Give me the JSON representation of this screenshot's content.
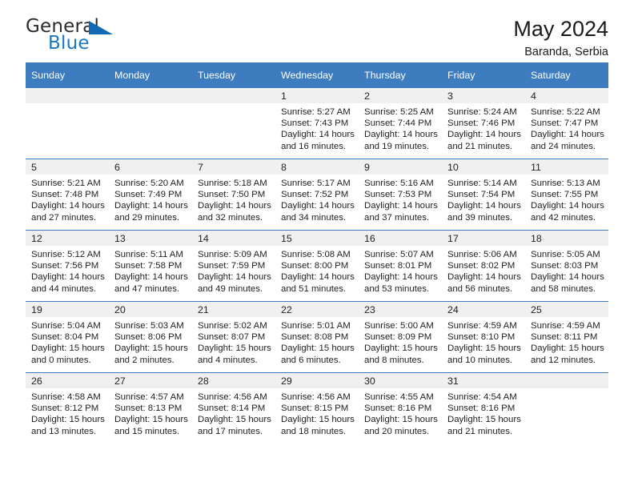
{
  "brand": {
    "name_top": "General",
    "name_bottom": "Blue",
    "accent_color": "#1168b3",
    "text_color": "#2b2b2b",
    "triangle_icon": "triangle-icon"
  },
  "header": {
    "title": "May 2024",
    "subtitle": "Baranda, Serbia",
    "header_bg": "#3c7cbf",
    "daynum_bg": "#f0f0f0"
  },
  "weekday_headers": [
    "Sunday",
    "Monday",
    "Tuesday",
    "Wednesday",
    "Thursday",
    "Friday",
    "Saturday"
  ],
  "labels": {
    "sunrise_prefix": "Sunrise:",
    "sunset_prefix": "Sunset:",
    "daylight_prefix": "Daylight:"
  },
  "weeks": [
    [
      {
        "day": "",
        "empty": true
      },
      {
        "day": "",
        "empty": true
      },
      {
        "day": "",
        "empty": true
      },
      {
        "day": "1",
        "sunrise": "Sunrise: 5:27 AM",
        "sunset": "Sunset: 7:43 PM",
        "daylight1": "Daylight: 14 hours",
        "daylight2": "and 16 minutes."
      },
      {
        "day": "2",
        "sunrise": "Sunrise: 5:25 AM",
        "sunset": "Sunset: 7:44 PM",
        "daylight1": "Daylight: 14 hours",
        "daylight2": "and 19 minutes."
      },
      {
        "day": "3",
        "sunrise": "Sunrise: 5:24 AM",
        "sunset": "Sunset: 7:46 PM",
        "daylight1": "Daylight: 14 hours",
        "daylight2": "and 21 minutes."
      },
      {
        "day": "4",
        "sunrise": "Sunrise: 5:22 AM",
        "sunset": "Sunset: 7:47 PM",
        "daylight1": "Daylight: 14 hours",
        "daylight2": "and 24 minutes."
      }
    ],
    [
      {
        "day": "5",
        "sunrise": "Sunrise: 5:21 AM",
        "sunset": "Sunset: 7:48 PM",
        "daylight1": "Daylight: 14 hours",
        "daylight2": "and 27 minutes."
      },
      {
        "day": "6",
        "sunrise": "Sunrise: 5:20 AM",
        "sunset": "Sunset: 7:49 PM",
        "daylight1": "Daylight: 14 hours",
        "daylight2": "and 29 minutes."
      },
      {
        "day": "7",
        "sunrise": "Sunrise: 5:18 AM",
        "sunset": "Sunset: 7:50 PM",
        "daylight1": "Daylight: 14 hours",
        "daylight2": "and 32 minutes."
      },
      {
        "day": "8",
        "sunrise": "Sunrise: 5:17 AM",
        "sunset": "Sunset: 7:52 PM",
        "daylight1": "Daylight: 14 hours",
        "daylight2": "and 34 minutes."
      },
      {
        "day": "9",
        "sunrise": "Sunrise: 5:16 AM",
        "sunset": "Sunset: 7:53 PM",
        "daylight1": "Daylight: 14 hours",
        "daylight2": "and 37 minutes."
      },
      {
        "day": "10",
        "sunrise": "Sunrise: 5:14 AM",
        "sunset": "Sunset: 7:54 PM",
        "daylight1": "Daylight: 14 hours",
        "daylight2": "and 39 minutes."
      },
      {
        "day": "11",
        "sunrise": "Sunrise: 5:13 AM",
        "sunset": "Sunset: 7:55 PM",
        "daylight1": "Daylight: 14 hours",
        "daylight2": "and 42 minutes."
      }
    ],
    [
      {
        "day": "12",
        "sunrise": "Sunrise: 5:12 AM",
        "sunset": "Sunset: 7:56 PM",
        "daylight1": "Daylight: 14 hours",
        "daylight2": "and 44 minutes."
      },
      {
        "day": "13",
        "sunrise": "Sunrise: 5:11 AM",
        "sunset": "Sunset: 7:58 PM",
        "daylight1": "Daylight: 14 hours",
        "daylight2": "and 47 minutes."
      },
      {
        "day": "14",
        "sunrise": "Sunrise: 5:09 AM",
        "sunset": "Sunset: 7:59 PM",
        "daylight1": "Daylight: 14 hours",
        "daylight2": "and 49 minutes."
      },
      {
        "day": "15",
        "sunrise": "Sunrise: 5:08 AM",
        "sunset": "Sunset: 8:00 PM",
        "daylight1": "Daylight: 14 hours",
        "daylight2": "and 51 minutes."
      },
      {
        "day": "16",
        "sunrise": "Sunrise: 5:07 AM",
        "sunset": "Sunset: 8:01 PM",
        "daylight1": "Daylight: 14 hours",
        "daylight2": "and 53 minutes."
      },
      {
        "day": "17",
        "sunrise": "Sunrise: 5:06 AM",
        "sunset": "Sunset: 8:02 PM",
        "daylight1": "Daylight: 14 hours",
        "daylight2": "and 56 minutes."
      },
      {
        "day": "18",
        "sunrise": "Sunrise: 5:05 AM",
        "sunset": "Sunset: 8:03 PM",
        "daylight1": "Daylight: 14 hours",
        "daylight2": "and 58 minutes."
      }
    ],
    [
      {
        "day": "19",
        "sunrise": "Sunrise: 5:04 AM",
        "sunset": "Sunset: 8:04 PM",
        "daylight1": "Daylight: 15 hours",
        "daylight2": "and 0 minutes."
      },
      {
        "day": "20",
        "sunrise": "Sunrise: 5:03 AM",
        "sunset": "Sunset: 8:06 PM",
        "daylight1": "Daylight: 15 hours",
        "daylight2": "and 2 minutes."
      },
      {
        "day": "21",
        "sunrise": "Sunrise: 5:02 AM",
        "sunset": "Sunset: 8:07 PM",
        "daylight1": "Daylight: 15 hours",
        "daylight2": "and 4 minutes."
      },
      {
        "day": "22",
        "sunrise": "Sunrise: 5:01 AM",
        "sunset": "Sunset: 8:08 PM",
        "daylight1": "Daylight: 15 hours",
        "daylight2": "and 6 minutes."
      },
      {
        "day": "23",
        "sunrise": "Sunrise: 5:00 AM",
        "sunset": "Sunset: 8:09 PM",
        "daylight1": "Daylight: 15 hours",
        "daylight2": "and 8 minutes."
      },
      {
        "day": "24",
        "sunrise": "Sunrise: 4:59 AM",
        "sunset": "Sunset: 8:10 PM",
        "daylight1": "Daylight: 15 hours",
        "daylight2": "and 10 minutes."
      },
      {
        "day": "25",
        "sunrise": "Sunrise: 4:59 AM",
        "sunset": "Sunset: 8:11 PM",
        "daylight1": "Daylight: 15 hours",
        "daylight2": "and 12 minutes."
      }
    ],
    [
      {
        "day": "26",
        "sunrise": "Sunrise: 4:58 AM",
        "sunset": "Sunset: 8:12 PM",
        "daylight1": "Daylight: 15 hours",
        "daylight2": "and 13 minutes."
      },
      {
        "day": "27",
        "sunrise": "Sunrise: 4:57 AM",
        "sunset": "Sunset: 8:13 PM",
        "daylight1": "Daylight: 15 hours",
        "daylight2": "and 15 minutes."
      },
      {
        "day": "28",
        "sunrise": "Sunrise: 4:56 AM",
        "sunset": "Sunset: 8:14 PM",
        "daylight1": "Daylight: 15 hours",
        "daylight2": "and 17 minutes."
      },
      {
        "day": "29",
        "sunrise": "Sunrise: 4:56 AM",
        "sunset": "Sunset: 8:15 PM",
        "daylight1": "Daylight: 15 hours",
        "daylight2": "and 18 minutes."
      },
      {
        "day": "30",
        "sunrise": "Sunrise: 4:55 AM",
        "sunset": "Sunset: 8:16 PM",
        "daylight1": "Daylight: 15 hours",
        "daylight2": "and 20 minutes."
      },
      {
        "day": "31",
        "sunrise": "Sunrise: 4:54 AM",
        "sunset": "Sunset: 8:16 PM",
        "daylight1": "Daylight: 15 hours",
        "daylight2": "and 21 minutes."
      },
      {
        "day": "",
        "empty": true
      }
    ]
  ]
}
